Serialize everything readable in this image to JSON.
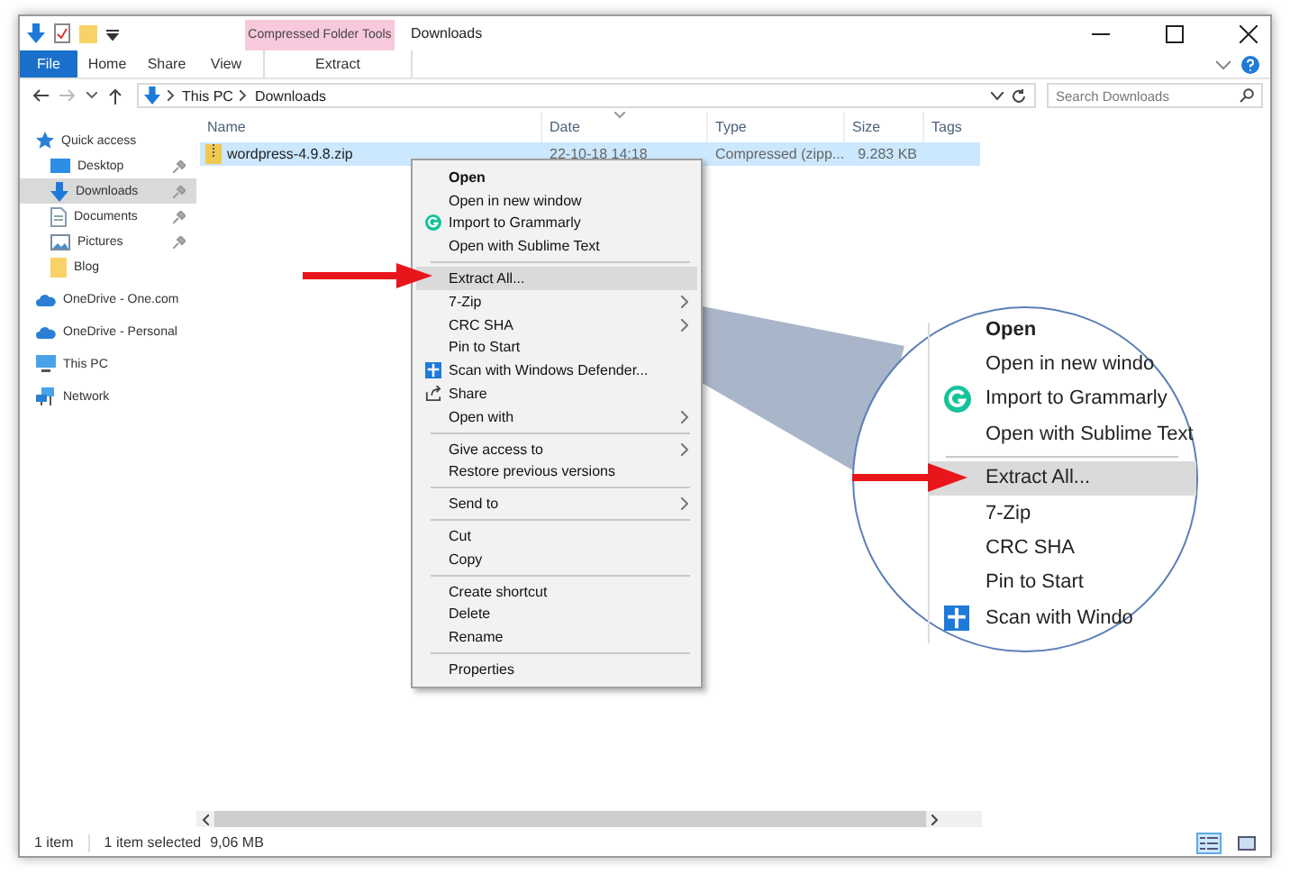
{
  "window": {
    "title": "Downloads"
  },
  "ribbon": {
    "contextual_group": "Compressed Folder Tools",
    "file_tab": "File",
    "tabs": [
      {
        "label": "Home"
      },
      {
        "label": "Share"
      },
      {
        "label": "View"
      }
    ],
    "contextual_tabs": [
      {
        "label": "Extract"
      }
    ]
  },
  "address_bar": {
    "path": [
      "This PC",
      "Downloads"
    ]
  },
  "search": {
    "placeholder": "Search Downloads"
  },
  "sidebar": {
    "items": [
      {
        "label": "Quick access",
        "kind": "star",
        "selected": false,
        "children": [
          {
            "label": "Desktop",
            "kind": "desktop",
            "pinned": true,
            "selected": false
          },
          {
            "label": "Downloads",
            "kind": "download",
            "pinned": true,
            "selected": true
          },
          {
            "label": "Documents",
            "kind": "document",
            "pinned": true,
            "selected": false
          },
          {
            "label": "Pictures",
            "kind": "pictures",
            "pinned": true,
            "selected": false
          },
          {
            "label": "Blog",
            "kind": "folder",
            "pinned": false,
            "selected": false
          }
        ]
      },
      {
        "label": "OneDrive - One.com",
        "kind": "cloud",
        "selected": false
      },
      {
        "label": "OneDrive - Personal",
        "kind": "cloud",
        "selected": false
      },
      {
        "label": "This PC",
        "kind": "pc",
        "selected": false
      },
      {
        "label": "Network",
        "kind": "network",
        "selected": false
      }
    ]
  },
  "file_list": {
    "columns": [
      "Name",
      "Date",
      "Type",
      "Size",
      "Tags"
    ],
    "rows": [
      {
        "name": "wordpress-4.9.8.zip",
        "date": "22-10-18 14:18",
        "type": "Compressed (zipp...",
        "size": "9.283 KB",
        "selected": true
      }
    ]
  },
  "context_menu": {
    "groups": [
      [
        {
          "label": "Open",
          "kind": "default",
          "submenu": false,
          "selected": false
        },
        {
          "label": "Open in new window",
          "kind": "plain",
          "submenu": false,
          "selected": false
        },
        {
          "label": "Import to Grammarly",
          "kind": "grammarly",
          "submenu": false,
          "selected": false
        },
        {
          "label": "Open with Sublime Text",
          "kind": "plain",
          "submenu": false,
          "selected": false
        }
      ],
      [
        {
          "label": "Extract All...",
          "kind": "plain",
          "submenu": false,
          "selected": true
        },
        {
          "label": "7-Zip",
          "kind": "plain",
          "submenu": true,
          "selected": false
        },
        {
          "label": "CRC SHA",
          "kind": "plain",
          "submenu": true,
          "selected": false
        },
        {
          "label": "Pin to Start",
          "kind": "plain",
          "submenu": false,
          "selected": false
        },
        {
          "label": "Scan with Windows Defender...",
          "kind": "shield",
          "submenu": false,
          "selected": false
        },
        {
          "label": "Share",
          "kind": "share",
          "submenu": false,
          "selected": false
        },
        {
          "label": "Open with",
          "kind": "plain",
          "submenu": true,
          "selected": false
        }
      ],
      [
        {
          "label": "Give access to",
          "kind": "plain",
          "submenu": true,
          "selected": false
        },
        {
          "label": "Restore previous versions",
          "kind": "plain",
          "submenu": false,
          "selected": false
        }
      ],
      [
        {
          "label": "Send to",
          "kind": "plain",
          "submenu": true,
          "selected": false
        }
      ],
      [
        {
          "label": "Cut",
          "kind": "plain",
          "submenu": false,
          "selected": false
        },
        {
          "label": "Copy",
          "kind": "plain",
          "submenu": false,
          "selected": false
        }
      ],
      [
        {
          "label": "Create shortcut",
          "kind": "plain",
          "submenu": false,
          "selected": false
        },
        {
          "label": "Delete",
          "kind": "plain",
          "submenu": false,
          "selected": false
        },
        {
          "label": "Rename",
          "kind": "plain",
          "submenu": false,
          "selected": false
        }
      ],
      [
        {
          "label": "Properties",
          "kind": "plain",
          "submenu": false,
          "selected": false
        }
      ]
    ]
  },
  "magnifier": {
    "groups": [
      [
        {
          "label": "Open",
          "kind": "default",
          "selected": false
        },
        {
          "label": "Open in new windo",
          "kind": "plain",
          "selected": false
        },
        {
          "label": "Import to Grammarly",
          "kind": "grammarly",
          "selected": false
        },
        {
          "label": "Open with Sublime Text",
          "kind": "plain",
          "selected": false
        }
      ],
      [
        {
          "label": "Extract All...",
          "kind": "plain",
          "selected": true
        },
        {
          "label": "7-Zip",
          "kind": "plain",
          "selected": false
        },
        {
          "label": "CRC SHA",
          "kind": "plain",
          "selected": false
        },
        {
          "label": "Pin to Start",
          "kind": "plain",
          "selected": false
        },
        {
          "label": "Scan with Windo",
          "kind": "shield",
          "selected": false
        }
      ]
    ]
  },
  "status_bar": {
    "item_count": "1 item",
    "selection": "1 item selected",
    "size": "9,06 MB",
    "views": [
      {
        "selected": true
      },
      {
        "selected": false
      }
    ]
  }
}
